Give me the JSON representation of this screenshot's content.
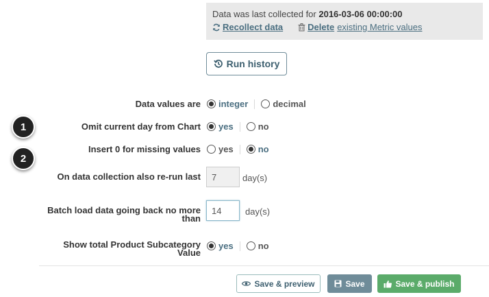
{
  "info": {
    "collected_prefix": "Data was last collected for",
    "collected_date": "2016-03-06 00:00:00",
    "recollect_label": "Recollect data",
    "delete_label": "Delete",
    "delete_rest": "existing Metric values"
  },
  "run_history_label": "Run history",
  "fields": {
    "data_values": {
      "label": "Data values are",
      "option1": "integer",
      "option2": "decimal",
      "selected": "integer"
    },
    "omit_current_day": {
      "label": "Omit current day from Chart",
      "option1": "yes",
      "option2": "no",
      "selected": "yes"
    },
    "insert_zero": {
      "label": "Insert 0 for missing values",
      "option1": "yes",
      "option2": "no",
      "selected": "no"
    },
    "rerun_last": {
      "label": "On data collection also re-run last",
      "value": "7",
      "unit": "day(s)"
    },
    "batch_load": {
      "label_line1": "Batch load data going back no more",
      "label_line2": "than",
      "value": "14",
      "unit": "day(s)"
    },
    "show_total": {
      "label_line1": "Show total Product Subcategory",
      "label_line2": "Value",
      "option1": "yes",
      "option2": "no",
      "selected": "yes"
    }
  },
  "badges": [
    "1",
    "2"
  ],
  "buttons": {
    "preview": "Save & preview",
    "save": "Save",
    "publish": "Save & publish"
  },
  "colors": {
    "accent": "#4a6e80",
    "save": "#6f8c99",
    "publish": "#5bab6a",
    "info_bg": "#e9e9e9"
  }
}
